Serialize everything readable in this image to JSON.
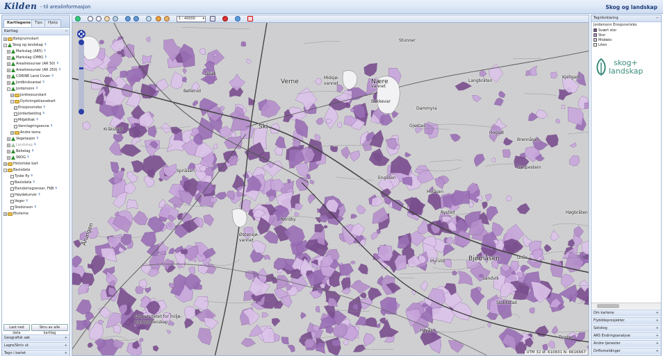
{
  "header": {
    "logo": "Kilden",
    "subtitle": "- til arealinformasjon",
    "theme": "Skog og landskap"
  },
  "left": {
    "tabs": [
      "Kartlagene",
      "Tips",
      "Hjelp"
    ],
    "section": "Kartlag",
    "tree": [
      {
        "label": "Bakgrunnskart",
        "icon": "folder",
        "level": 0,
        "toggle": "+"
      },
      {
        "label": "Skog og landskap",
        "icon": "tree",
        "level": 0,
        "toggle": "-",
        "info": "$"
      },
      {
        "label": "Markslag (AR5)",
        "icon": "tree",
        "level": 1,
        "toggle": "+",
        "info": "$"
      },
      {
        "label": "Markslag (DMK)",
        "icon": "tree",
        "level": 1,
        "toggle": "+",
        "info": "$"
      },
      {
        "label": "Arealressurser (AR 50)",
        "icon": "tree",
        "level": 1,
        "toggle": "+",
        "info": "$"
      },
      {
        "label": "Arealressurser (AR 250)",
        "icon": "tree",
        "level": 1,
        "toggle": "+",
        "info": "$"
      },
      {
        "label": "CORINE Land Cover",
        "icon": "tree",
        "level": 1,
        "toggle": "+",
        "info": "$"
      },
      {
        "label": "Jordbruksareal",
        "icon": "tree",
        "level": 1,
        "toggle": "+",
        "info": "$"
      },
      {
        "label": "Jordsmonn",
        "icon": "tree",
        "level": 1,
        "toggle": "-",
        "info": "$"
      },
      {
        "label": "Jordressurskart",
        "icon": "folder",
        "level": 2,
        "toggle": "+"
      },
      {
        "label": "Dyrkningsklassekart",
        "icon": "folder",
        "level": 2,
        "toggle": "-"
      },
      {
        "label": "Erosjonsrisiko",
        "icon": "checked",
        "level": 3,
        "info": "$"
      },
      {
        "label": "Jordarbeiding",
        "icon": "check",
        "level": 3,
        "info": "$"
      },
      {
        "label": "Miljøtiltak",
        "icon": "check",
        "level": 3,
        "info": "$"
      },
      {
        "label": "Vannlagringsevne",
        "icon": "check",
        "level": 3,
        "info": "$"
      },
      {
        "label": "Andre tema",
        "icon": "folder",
        "level": 2,
        "toggle": "+"
      },
      {
        "label": "Vegetasjon",
        "icon": "tree",
        "level": 1,
        "toggle": "+",
        "info": "$"
      },
      {
        "label": "Landskap",
        "icon": "tree-grey",
        "level": 1,
        "toggle": "+",
        "info": "$",
        "disabled": true
      },
      {
        "label": "Beitelag",
        "icon": "tree",
        "level": 1,
        "toggle": "+",
        "info": "$"
      },
      {
        "label": "SKOG",
        "icon": "tree",
        "level": 1,
        "toggle": "+",
        "info": "$"
      },
      {
        "label": "Historiske kart",
        "icon": "folder",
        "level": 0,
        "toggle": "+"
      },
      {
        "label": "Basisdata",
        "icon": "folder",
        "level": 0,
        "toggle": "-"
      },
      {
        "label": "Tyske fly",
        "icon": "check",
        "level": 2,
        "info": "$"
      },
      {
        "label": "Basisdata",
        "icon": "check",
        "level": 2,
        "info": "$"
      },
      {
        "label": "Eiendomsgrenser, FKB",
        "icon": "check",
        "level": 2,
        "info": "$"
      },
      {
        "label": "Høydekurver",
        "icon": "check",
        "level": 2,
        "info": "$"
      },
      {
        "label": "Veger",
        "icon": "check",
        "level": 2,
        "info": "$"
      },
      {
        "label": "Stedsnavn",
        "icon": "check",
        "level": 2,
        "info": "$"
      },
      {
        "label": "Eksterne",
        "icon": "folder",
        "level": 0,
        "toggle": "+"
      }
    ],
    "btn_download": "Last ned data",
    "btn_off": "Skru av alle kartlag",
    "accordions": [
      "Geografisk søk",
      "Lagre/Skriv ut",
      "Tegn i kartet"
    ]
  },
  "map": {
    "scale": "1 : 40000",
    "coords": "UTM 32 Ø: 610831 N: 6616667",
    "labels": [
      {
        "t": "Stunner",
        "big": false
      },
      {
        "t": "Verne",
        "big": true
      },
      {
        "t": "Midsjø-",
        "big": false
      },
      {
        "t": "vannet",
        "big": false
      },
      {
        "t": "Nære",
        "big": true
      },
      {
        "t": "vannet",
        "big": false
      },
      {
        "t": "Bekkevar",
        "big": false
      },
      {
        "t": "Ski",
        "big": true
      },
      {
        "t": "Spriåsen",
        "big": false
      },
      {
        "t": "Engåsen",
        "big": false
      },
      {
        "t": "Holåsen",
        "big": false
      },
      {
        "t": "Nordby",
        "big": false
      },
      {
        "t": "Østensjø-",
        "big": false
      },
      {
        "t": "vannet",
        "big": false
      },
      {
        "t": "Bjørnåsen",
        "big": true
      },
      {
        "t": "Stokkstad",
        "big": false
      },
      {
        "t": "Kråkstad",
        "big": false
      },
      {
        "t": "Tallak",
        "big": false
      },
      {
        "t": "Bøllerud",
        "big": false
      },
      {
        "t": "Hogset",
        "big": false
      },
      {
        "t": "Brennåsen",
        "big": false
      },
      {
        "t": "Gaupestein",
        "big": false
      },
      {
        "t": "Høgbråten",
        "big": false
      },
      {
        "t": "Unås",
        "big": false
      },
      {
        "t": "Tomter",
        "big": false
      },
      {
        "t": "Årungen",
        "big": false
      },
      {
        "t": "Universitetet for miljø-",
        "big": false
      },
      {
        "t": "og biovitenskap",
        "big": false
      },
      {
        "t": "Kjellgard",
        "big": false
      },
      {
        "t": "Rystad",
        "big": false
      },
      {
        "t": "Myrvoll",
        "big": false
      },
      {
        "t": "Høyås",
        "big": false
      },
      {
        "t": "Sandvik",
        "big": false
      },
      {
        "t": "Langbråten",
        "big": false
      },
      {
        "t": "Dammyra",
        "big": false
      },
      {
        "t": "Gjestad",
        "big": false
      }
    ]
  },
  "right": {
    "legend_header": "Tegnforklaring",
    "legend_title": "Jordsmonn Erosjonsrisiko",
    "legend": [
      {
        "label": "Svært stor",
        "color": "#7a4f8e"
      },
      {
        "label": "Stor",
        "color": "#b58fcb"
      },
      {
        "label": "Middels",
        "color": "#dcc3ea"
      },
      {
        "label": "Liten",
        "color": "#ffffff"
      }
    ],
    "logo_line1": "skog+",
    "logo_line2": "landskap",
    "accordions": [
      "Om kartene",
      "Flybildeprosjekter",
      "Satskog",
      "AR5 Endringsanalyse",
      "Andre tjenester",
      "Driftsmeldinger"
    ]
  }
}
